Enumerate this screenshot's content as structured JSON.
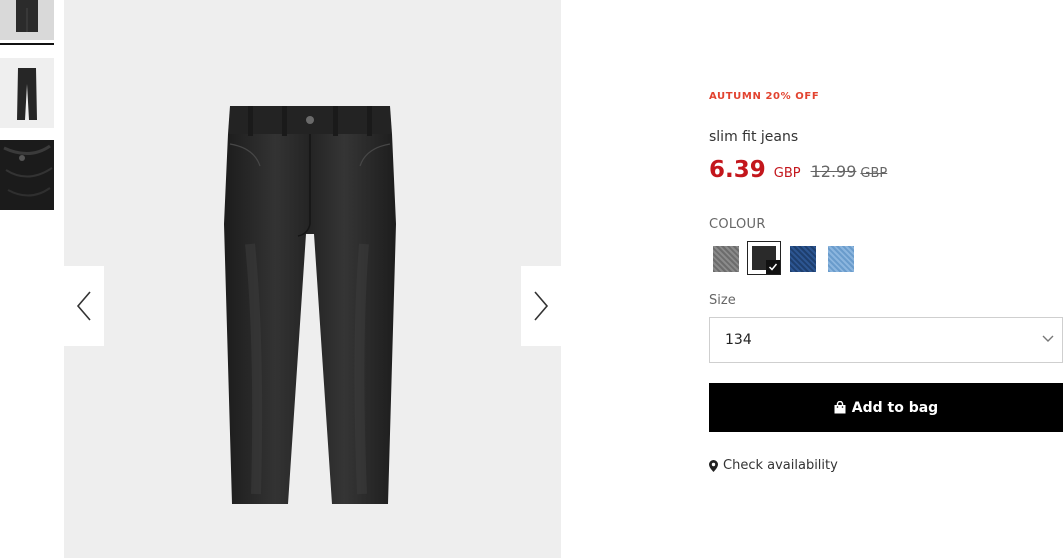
{
  "gallery": {
    "thumbnails": [
      {
        "name": "thumbnail-front-crop",
        "active": true
      },
      {
        "name": "thumbnail-front",
        "active": false
      },
      {
        "name": "thumbnail-detail",
        "active": false
      }
    ],
    "prev_icon": "chevron-left-icon",
    "next_icon": "chevron-right-icon"
  },
  "product": {
    "promo": "AUTUMN 20% OFF",
    "title": "slim fit jeans",
    "price": "6.39",
    "currency": "GBP",
    "old_price": "12.99",
    "old_currency": "GBP",
    "colour_label": "COLOUR",
    "colours": [
      {
        "name": "grey",
        "hex": "#7a7a7a",
        "selected": false
      },
      {
        "name": "black",
        "hex": "#2a2a2a",
        "selected": true
      },
      {
        "name": "dark-blue",
        "hex": "#24497e",
        "selected": false
      },
      {
        "name": "light-blue",
        "hex": "#7aaad6",
        "selected": false
      }
    ],
    "size_label": "Size",
    "size_value": "134",
    "add_to_bag": "Add to bag",
    "check_availability": "Check availability"
  },
  "colors": {
    "promo": "#e2432f",
    "price": "#c3161c",
    "button": "#000000"
  }
}
